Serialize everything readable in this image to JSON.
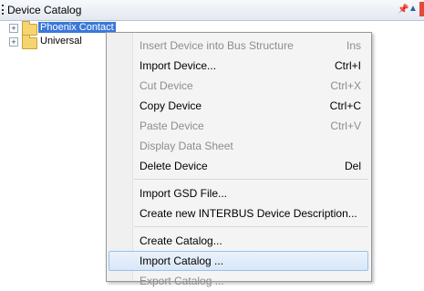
{
  "panel": {
    "title": "Device Catalog"
  },
  "tree": {
    "nodes": [
      {
        "label": "Phoenix Contact",
        "selected": true
      },
      {
        "label": "Universal",
        "selected": false
      }
    ]
  },
  "context_menu": {
    "items": [
      {
        "label": "Insert Device into Bus Structure",
        "shortcut": "Ins",
        "enabled": false
      },
      {
        "label": "Import Device...",
        "shortcut": "Ctrl+I",
        "enabled": true
      },
      {
        "label": "Cut Device",
        "shortcut": "Ctrl+X",
        "enabled": false
      },
      {
        "label": "Copy Device",
        "shortcut": "Ctrl+C",
        "enabled": true
      },
      {
        "label": "Paste Device",
        "shortcut": "Ctrl+V",
        "enabled": false
      },
      {
        "label": "Display Data Sheet",
        "shortcut": "",
        "enabled": false
      },
      {
        "label": "Delete Device",
        "shortcut": "Del",
        "enabled": true
      },
      {
        "label": "Import GSD File...",
        "shortcut": "",
        "enabled": true
      },
      {
        "label": "Create new INTERBUS Device Description...",
        "shortcut": "",
        "enabled": true
      },
      {
        "label": "Create Catalog...",
        "shortcut": "",
        "enabled": true
      },
      {
        "label": "Import Catalog ...",
        "shortcut": "",
        "enabled": true,
        "highlighted": true
      },
      {
        "label": "Export Catalog ...",
        "shortcut": "",
        "enabled": false
      }
    ]
  }
}
